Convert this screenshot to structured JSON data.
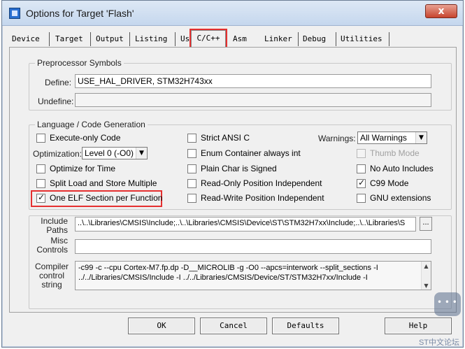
{
  "window": {
    "title": "Options for Target 'Flash'",
    "close_glyph": "x"
  },
  "tabs": [
    {
      "label": "Device"
    },
    {
      "label": "Target"
    },
    {
      "label": "Output"
    },
    {
      "label": "Listing"
    },
    {
      "label": "User"
    },
    {
      "label": "C/C++",
      "active": true
    },
    {
      "label": "Asm"
    },
    {
      "label": "Linker"
    },
    {
      "label": "Debug"
    },
    {
      "label": "Utilities"
    }
  ],
  "preprocessor": {
    "group_label": "Preprocessor Symbols",
    "define_label": "Define:",
    "define_value": "USE_HAL_DRIVER, STM32H743xx",
    "undefine_label": "Undefine:",
    "undefine_value": ""
  },
  "language": {
    "group_label": "Language / Code Generation",
    "execute_only": {
      "label": "Execute-only Code",
      "checked": false
    },
    "optimization_label": "Optimization:",
    "optimization_value": "Level 0 (-O0)",
    "optimize_time": {
      "label": "Optimize for Time",
      "checked": false
    },
    "split_load": {
      "label": "Split Load and Store Multiple",
      "checked": false
    },
    "one_elf": {
      "label": "One ELF Section per Function",
      "checked": true
    },
    "strict_ansi": {
      "label": "Strict ANSI C",
      "checked": false
    },
    "enum_container": {
      "label": "Enum Container always int",
      "checked": false
    },
    "plain_char": {
      "label": "Plain Char is Signed",
      "checked": false
    },
    "ro_pi": {
      "label": "Read-Only Position Independent",
      "checked": false
    },
    "rw_pi": {
      "label": "Read-Write Position Independent",
      "checked": false
    },
    "warnings_label": "Warnings:",
    "warnings_value": "All Warnings",
    "thumb_mode": {
      "label": "Thumb Mode",
      "checked": false,
      "disabled": true
    },
    "no_auto_includes": {
      "label": "No Auto Includes",
      "checked": false
    },
    "c99_mode": {
      "label": "C99 Mode",
      "checked": true
    },
    "gnu_extensions": {
      "label": "GNU extensions",
      "checked": false
    }
  },
  "paths": {
    "include_label_1": "Include",
    "include_label_2": "Paths",
    "include_value": "..\\..\\Libraries\\CMSIS\\Include;..\\..\\Libraries\\CMSIS\\Device\\ST\\STM32H7xx\\Include;..\\..\\Libraries\\S",
    "browse_label": "...",
    "misc_label_1": "Misc",
    "misc_label_2": "Controls",
    "misc_value": ""
  },
  "compiler": {
    "label_1": "Compiler",
    "label_2": "control",
    "label_3": "string",
    "line_1": "-c99 -c --cpu Cortex-M7.fp.dp -D__MICROLIB -g -O0 --apcs=interwork --split_sections -I",
    "line_2": "../../Libraries/CMSIS/Include -I ../../Libraries/CMSIS/Device/ST/STM32H7xx/Include -I"
  },
  "buttons": {
    "ok": "OK",
    "cancel": "Cancel",
    "defaults": "Defaults",
    "help": "Help"
  },
  "watermark": {
    "text": "ST中文论坛"
  },
  "colors": {
    "highlight": "#e53030",
    "titlebar": "#c5d7ee"
  }
}
